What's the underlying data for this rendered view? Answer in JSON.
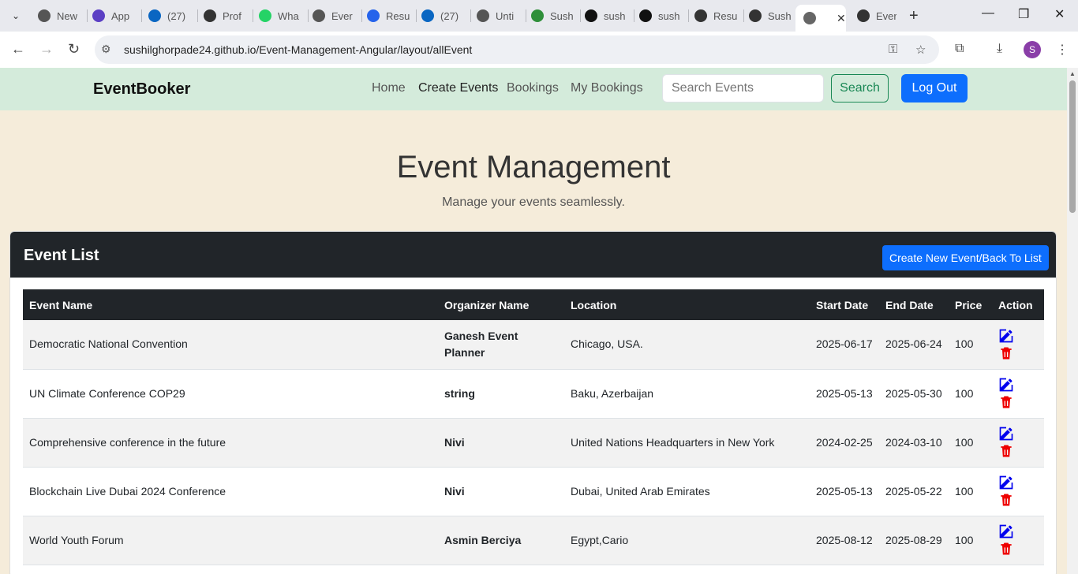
{
  "browser": {
    "tabs": [
      {
        "label": "New",
        "color": "#555"
      },
      {
        "label": "App",
        "color": "#5b3fc4"
      },
      {
        "label": "(27)",
        "color": "#0a66c2"
      },
      {
        "label": "Prof",
        "color": "#333"
      },
      {
        "label": "Wha",
        "color": "#25d366"
      },
      {
        "label": "Ever",
        "color": "#555"
      },
      {
        "label": "Resu",
        "color": "#2563eb"
      },
      {
        "label": "(27)",
        "color": "#0a66c2"
      },
      {
        "label": "Unti",
        "color": "#555"
      },
      {
        "label": "Sush",
        "color": "#2f8f3a"
      },
      {
        "label": "sush",
        "color": "#111"
      },
      {
        "label": "sush",
        "color": "#111"
      },
      {
        "label": "Resu",
        "color": "#333"
      },
      {
        "label": "Sush",
        "color": "#333"
      }
    ],
    "active_tab_close": "✕",
    "last_tab": {
      "label": "Ever",
      "color": "#333"
    },
    "url": "sushilghorpade24.github.io/Event-Management-Angular/layout/allEvent",
    "profile_initial": "S"
  },
  "navbar": {
    "brand": "EventBooker",
    "links": [
      "Home",
      "Create Events",
      "Bookings",
      "My Bookings"
    ],
    "search_placeholder": "Search Events",
    "search_button": "Search",
    "logout_button": "Log Out"
  },
  "hero": {
    "title": "Event Management",
    "subtitle": "Manage your events seamlessly."
  },
  "event_list": {
    "title": "Event List",
    "create_button": "Create New Event/Back To List",
    "columns": [
      "Event Name",
      "Organizer Name",
      "Location",
      "Start Date",
      "End Date",
      "Price",
      "Action"
    ],
    "rows": [
      {
        "name": "Democratic National Convention",
        "organizer": "Ganesh Event Planner",
        "location": "Chicago, USA.",
        "start": "2025-06-17",
        "end": "2025-06-24",
        "price": "100"
      },
      {
        "name": "UN Climate Conference COP29",
        "organizer": "string",
        "location": "Baku, Azerbaijan",
        "start": "2025-05-13",
        "end": "2025-05-30",
        "price": "100"
      },
      {
        "name": "Comprehensive conference in the future",
        "organizer": "Nivi",
        "location": "United Nations Headquarters in New York",
        "start": "2024-02-25",
        "end": "2024-03-10",
        "price": "100"
      },
      {
        "name": "Blockchain Live Dubai 2024 Conference",
        "organizer": "Nivi",
        "location": "Dubai, United Arab Emirates",
        "start": "2025-05-13",
        "end": "2025-05-22",
        "price": "100"
      },
      {
        "name": "World Youth Forum",
        "organizer": "Asmin Berciya",
        "location": "Egypt,Cario",
        "start": "2025-08-12",
        "end": "2025-08-29",
        "price": "100"
      }
    ]
  },
  "colors": {
    "navbar_bg": "#d4ebdb",
    "page_bg": "#f5ecda",
    "edit_icon": "#0000ee",
    "delete_icon": "#ee0000",
    "primary": "#0d6efd"
  }
}
